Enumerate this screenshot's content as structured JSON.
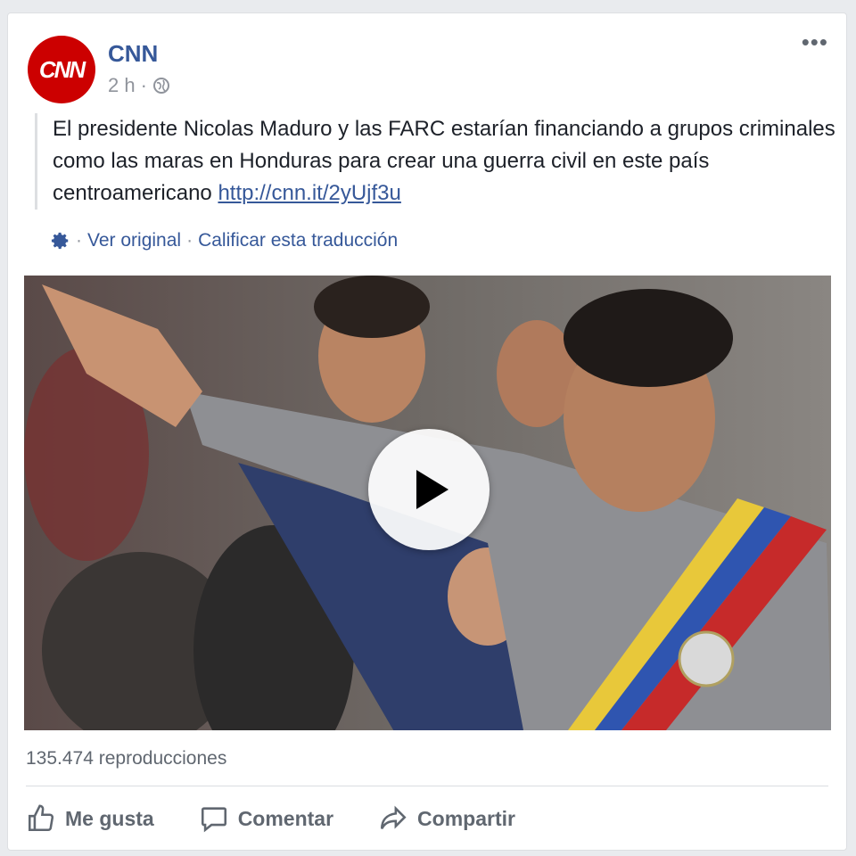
{
  "post": {
    "author": "CNN",
    "avatar_text": "CNN",
    "time": "2 h",
    "separator": "·",
    "text": "El presidente Nicolas Maduro y las FARC estarían financiando a grupos criminales como las maras en Honduras para crear una guerra civil en este país centroamericano",
    "link": "http://cnn.it/2yUjf3u",
    "more_label": "•••"
  },
  "translation": {
    "view_original": "Ver original",
    "rate": "Calificar esta traducción",
    "separator": "·"
  },
  "video": {
    "views": "135.474 reproducciones"
  },
  "actions": {
    "like": "Me gusta",
    "comment": "Comentar",
    "share": "Compartir"
  },
  "colors": {
    "brand": "#cc0000",
    "link": "#365899",
    "muted": "#606770"
  }
}
